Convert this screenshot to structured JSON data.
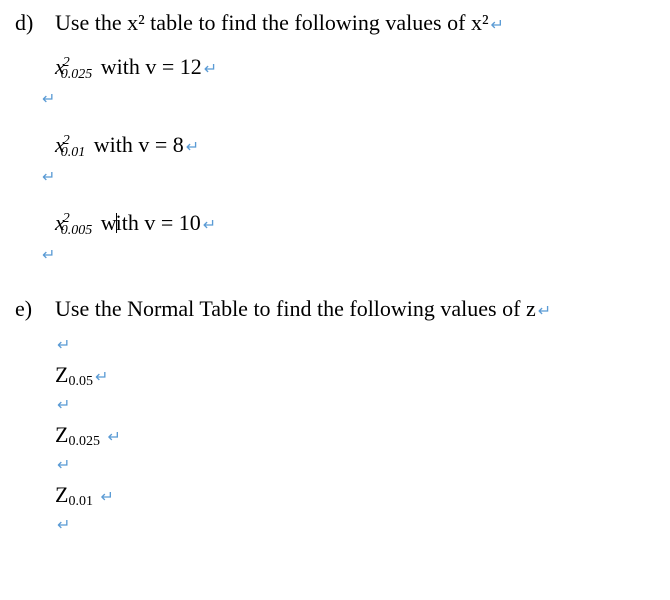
{
  "d": {
    "label": "d)",
    "question": "Use the x² table to find the following values of x²",
    "sub1_chi_sub": "0.025",
    "sub1_text": " with v = 12",
    "sub2_chi_sub": "0.01",
    "sub2_text": " with v = 8",
    "sub3_chi_sub": "0.005",
    "sub3_text_before": " w",
    "sub3_text_after": "ith v = 10"
  },
  "e": {
    "label": "e)",
    "question": "Use the Normal Table to find the following values of z",
    "z1": "0.05",
    "z2": "0.025",
    "z3": "0.01"
  },
  "return_glyph": "↵"
}
